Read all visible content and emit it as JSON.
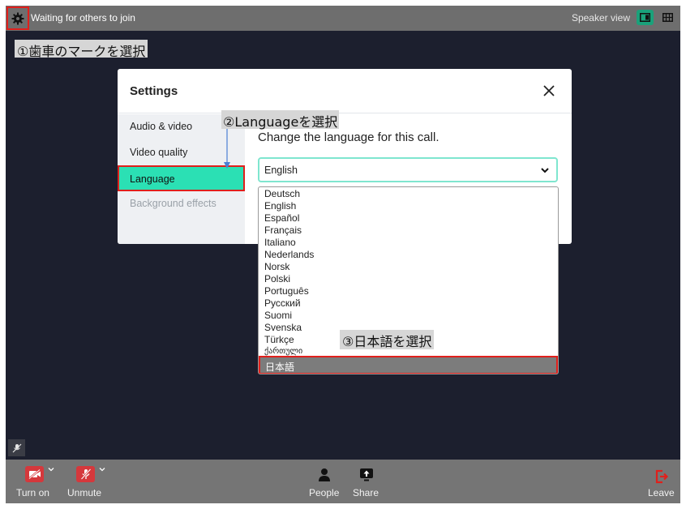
{
  "topbar": {
    "status_text": "Waiting for others to join",
    "view_label": "Speaker view"
  },
  "annotations": {
    "step1": "①歯車のマークを選択",
    "step2": "②Languageを選択",
    "step3": "③日本語を選択"
  },
  "dialog": {
    "title": "Settings",
    "sidebar": [
      "Audio & video",
      "Video quality",
      "Language",
      "Background effects"
    ],
    "heading": "Change the language for this call.",
    "selected_value": "English"
  },
  "language_options": [
    "Deutsch",
    "English",
    "Español",
    "Français",
    "Italiano",
    "Nederlands",
    "Norsk",
    "Polski",
    "Português",
    "Русский",
    "Suomi",
    "Svenska",
    "Türkçe",
    "ქართული",
    "日本語"
  ],
  "bottombar": {
    "camera_label": "Turn on",
    "mic_label": "Unmute",
    "people_label": "People",
    "share_label": "Share",
    "leave_label": "Leave"
  },
  "colors": {
    "accent": "#2be0b4",
    "highlight_border": "#e0201c",
    "danger": "#d5383c",
    "background": "#1c1f2e"
  },
  "icons": [
    "gear-icon",
    "speaker-view-icon",
    "grid-view-icon",
    "close-icon",
    "chevron-down-icon",
    "camera-off-icon",
    "mic-off-icon",
    "people-icon",
    "share-icon",
    "leave-icon"
  ]
}
